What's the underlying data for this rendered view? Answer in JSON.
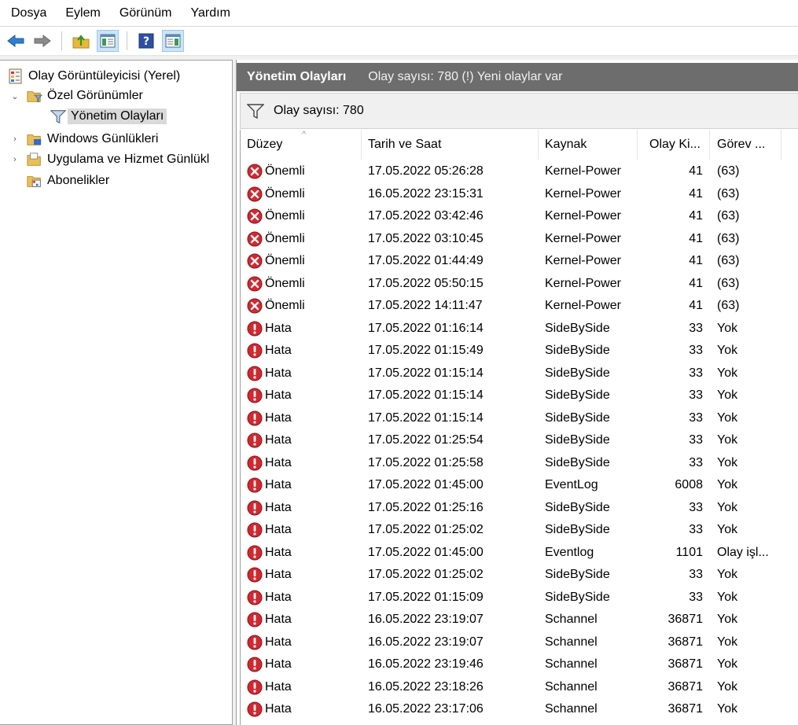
{
  "menu": [
    "Dosya",
    "Eylem",
    "Görünüm",
    "Yardım"
  ],
  "toolbar": {
    "icons": [
      "back-arrow-icon",
      "forward-arrow-icon",
      "up-folder-icon",
      "show-hide-tree-icon",
      "help-icon",
      "show-hide-action-pane-icon"
    ]
  },
  "tree": {
    "root": "Olay Görüntüleyicisi (Yerel)",
    "custom_views": "Özel Görünümler",
    "admin_events": "Yönetim Olayları",
    "windows_logs": "Windows Günlükleri",
    "app_service_logs": "Uygulama ve Hizmet Günlükl",
    "subscriptions": "Abonelikler"
  },
  "panel": {
    "title": "Yönetim Olayları",
    "subtitle": "Olay sayısı: 780 (!) Yeni olaylar var",
    "filter_text": "Olay sayısı: 780"
  },
  "columns": [
    "Düzey",
    "Tarih ve Saat",
    "Kaynak",
    "Olay Ki...",
    "Görev ..."
  ],
  "rows": [
    {
      "level": "critical",
      "level_text": "Önemli",
      "date": "17.05.2022 05:26:28",
      "source": "Kernel-Power",
      "id": "41",
      "task": "(63)"
    },
    {
      "level": "critical",
      "level_text": "Önemli",
      "date": "16.05.2022 23:15:31",
      "source": "Kernel-Power",
      "id": "41",
      "task": "(63)"
    },
    {
      "level": "critical",
      "level_text": "Önemli",
      "date": "17.05.2022 03:42:46",
      "source": "Kernel-Power",
      "id": "41",
      "task": "(63)"
    },
    {
      "level": "critical",
      "level_text": "Önemli",
      "date": "17.05.2022 03:10:45",
      "source": "Kernel-Power",
      "id": "41",
      "task": "(63)"
    },
    {
      "level": "critical",
      "level_text": "Önemli",
      "date": "17.05.2022 01:44:49",
      "source": "Kernel-Power",
      "id": "41",
      "task": "(63)"
    },
    {
      "level": "critical",
      "level_text": "Önemli",
      "date": "17.05.2022 05:50:15",
      "source": "Kernel-Power",
      "id": "41",
      "task": "(63)"
    },
    {
      "level": "critical",
      "level_text": "Önemli",
      "date": "17.05.2022 14:11:47",
      "source": "Kernel-Power",
      "id": "41",
      "task": "(63)"
    },
    {
      "level": "error",
      "level_text": "Hata",
      "date": "17.05.2022 01:16:14",
      "source": "SideBySide",
      "id": "33",
      "task": "Yok"
    },
    {
      "level": "error",
      "level_text": "Hata",
      "date": "17.05.2022 01:15:49",
      "source": "SideBySide",
      "id": "33",
      "task": "Yok"
    },
    {
      "level": "error",
      "level_text": "Hata",
      "date": "17.05.2022 01:15:14",
      "source": "SideBySide",
      "id": "33",
      "task": "Yok"
    },
    {
      "level": "error",
      "level_text": "Hata",
      "date": "17.05.2022 01:15:14",
      "source": "SideBySide",
      "id": "33",
      "task": "Yok"
    },
    {
      "level": "error",
      "level_text": "Hata",
      "date": "17.05.2022 01:15:14",
      "source": "SideBySide",
      "id": "33",
      "task": "Yok"
    },
    {
      "level": "error",
      "level_text": "Hata",
      "date": "17.05.2022 01:25:54",
      "source": "SideBySide",
      "id": "33",
      "task": "Yok"
    },
    {
      "level": "error",
      "level_text": "Hata",
      "date": "17.05.2022 01:25:58",
      "source": "SideBySide",
      "id": "33",
      "task": "Yok"
    },
    {
      "level": "error",
      "level_text": "Hata",
      "date": "17.05.2022 01:45:00",
      "source": "EventLog",
      "id": "6008",
      "task": "Yok"
    },
    {
      "level": "error",
      "level_text": "Hata",
      "date": "17.05.2022 01:25:16",
      "source": "SideBySide",
      "id": "33",
      "task": "Yok"
    },
    {
      "level": "error",
      "level_text": "Hata",
      "date": "17.05.2022 01:25:02",
      "source": "SideBySide",
      "id": "33",
      "task": "Yok"
    },
    {
      "level": "error",
      "level_text": "Hata",
      "date": "17.05.2022 01:45:00",
      "source": "Eventlog",
      "id": "1101",
      "task": "Olay işl..."
    },
    {
      "level": "error",
      "level_text": "Hata",
      "date": "17.05.2022 01:25:02",
      "source": "SideBySide",
      "id": "33",
      "task": "Yok"
    },
    {
      "level": "error",
      "level_text": "Hata",
      "date": "17.05.2022 01:15:09",
      "source": "SideBySide",
      "id": "33",
      "task": "Yok"
    },
    {
      "level": "error",
      "level_text": "Hata",
      "date": "16.05.2022 23:19:07",
      "source": "Schannel",
      "id": "36871",
      "task": "Yok"
    },
    {
      "level": "error",
      "level_text": "Hata",
      "date": "16.05.2022 23:19:07",
      "source": "Schannel",
      "id": "36871",
      "task": "Yok"
    },
    {
      "level": "error",
      "level_text": "Hata",
      "date": "16.05.2022 23:19:46",
      "source": "Schannel",
      "id": "36871",
      "task": "Yok"
    },
    {
      "level": "error",
      "level_text": "Hata",
      "date": "16.05.2022 23:18:26",
      "source": "Schannel",
      "id": "36871",
      "task": "Yok"
    },
    {
      "level": "error",
      "level_text": "Hata",
      "date": "16.05.2022 23:17:06",
      "source": "Schannel",
      "id": "36871",
      "task": "Yok"
    }
  ]
}
